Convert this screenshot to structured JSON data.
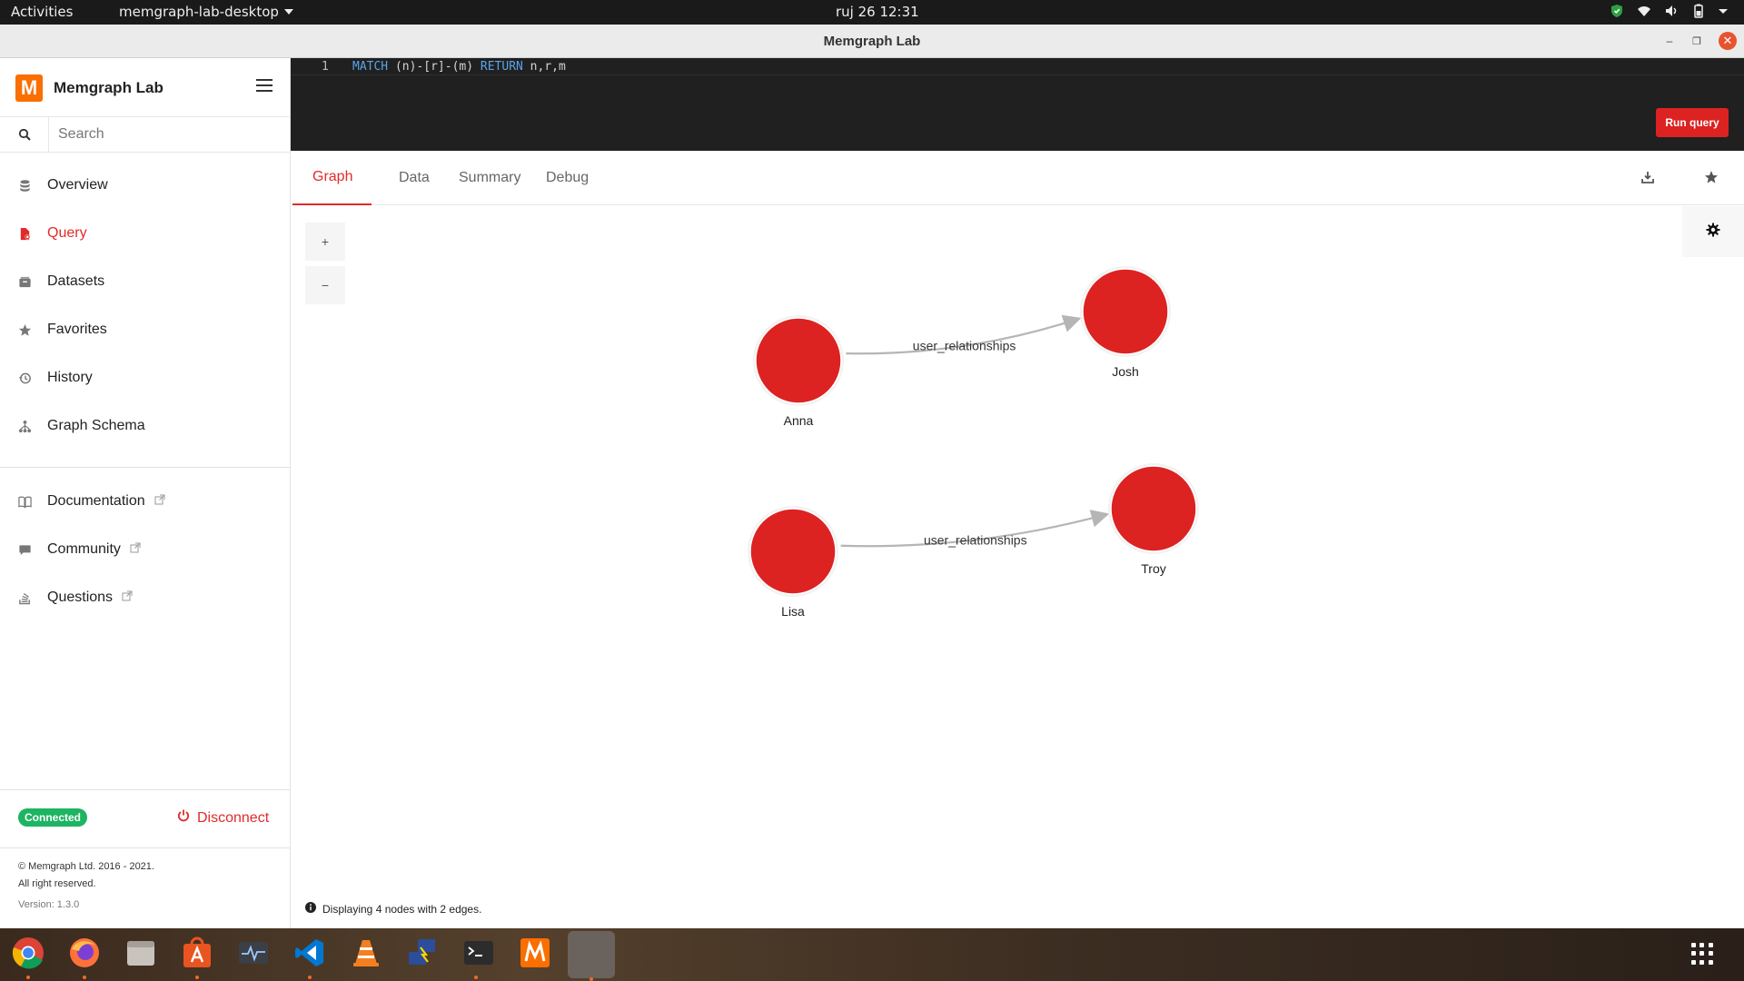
{
  "system": {
    "activities": "Activities",
    "app_menu": "memgraph-lab-desktop",
    "clock": "ruj 26  12:31"
  },
  "window": {
    "title": "Memgraph Lab"
  },
  "sidebar": {
    "brand": "Memgraph Lab",
    "search_placeholder": "Search",
    "nav": [
      {
        "label": "Overview",
        "icon": "database-icon"
      },
      {
        "label": "Query",
        "icon": "query-file-icon",
        "active": true
      },
      {
        "label": "Datasets",
        "icon": "datasets-icon"
      },
      {
        "label": "Favorites",
        "icon": "star-icon"
      },
      {
        "label": "History",
        "icon": "history-icon"
      },
      {
        "label": "Graph Schema",
        "icon": "graph-schema-icon"
      }
    ],
    "links": [
      {
        "label": "Documentation",
        "icon": "book-icon"
      },
      {
        "label": "Community",
        "icon": "chat-icon"
      },
      {
        "label": "Questions",
        "icon": "stack-icon"
      }
    ],
    "status": "Connected",
    "disconnect": "Disconnect",
    "copyright": "© Memgraph Ltd. 2016 - 2021.",
    "rights": "All right reserved.",
    "version": "Version: 1.3.0"
  },
  "editor": {
    "line_number": "1",
    "kw_match": "MATCH",
    "pattern": " (n)-[r]-(m) ",
    "kw_return": "RETURN",
    "tail": " n,r,m",
    "run_label": "Run query"
  },
  "tabs": [
    "Graph",
    "Data",
    "Summary",
    "Debug"
  ],
  "graph": {
    "zoom_in": "+",
    "zoom_out": "−",
    "node_color": "#dd2222",
    "nodes": [
      {
        "label": "Anna"
      },
      {
        "label": "Josh"
      },
      {
        "label": "Lisa"
      },
      {
        "label": "Troy"
      }
    ],
    "edges": [
      {
        "from": "Anna",
        "to": "Josh",
        "label": "user_relationships"
      },
      {
        "from": "Lisa",
        "to": "Troy",
        "label": "user_relationships"
      }
    ],
    "info": "Displaying 4 nodes with 2 edges."
  },
  "colors": {
    "accent": "#e12a2a",
    "connected": "#1db462",
    "editor_bg": "#202020"
  }
}
